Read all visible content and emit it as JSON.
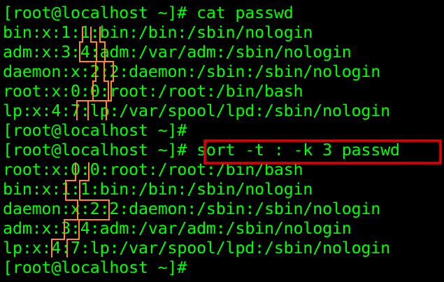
{
  "colors": {
    "background": "#000000",
    "text": "#00ff00",
    "field_highlight": "#ff8c1a",
    "command_highlight": "#e00000"
  },
  "terminal": {
    "lines": [
      "[root@localhost ~]# cat passwd",
      "bin:x:1:1:bin:/bin:/sbin/nologin",
      "adm:x:3:4:adm:/var/adm:/sbin/nologin",
      "daemon:x:2:2:daemon:/sbin:/sbin/nologin",
      "root:x:0:0:root:/root:/bin/bash",
      "lp:x:4:7:lp:/var/spool/lpd:/sbin/nologin",
      "[root@localhost ~]#",
      "[root@localhost ~]# sort -t : -k 3 passwd",
      "root:x:0:0:root:/root:/bin/bash",
      "bin:x:1:1:bin:/bin:/sbin/nologin",
      "daemon:x:2:2:daemon:/sbin:/sbin/nologin",
      "adm:x:3:4:adm:/var/adm:/sbin/nologin",
      "lp:x:4:7:lp:/var/spool/lpd:/sbin/nologin",
      "[root@localhost ~]#"
    ]
  }
}
